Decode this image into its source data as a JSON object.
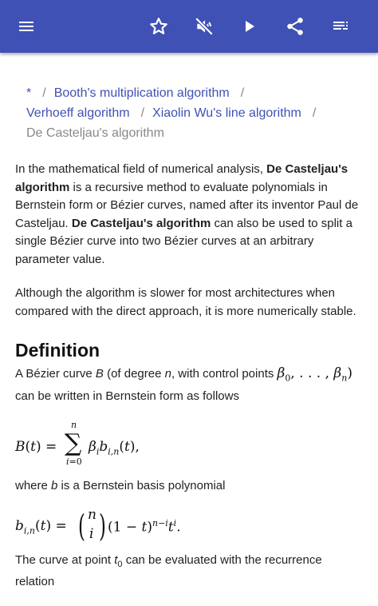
{
  "toolbar": {
    "menu_icon": "menu-icon",
    "actions": [
      "star-icon",
      "volume-off-icon",
      "play-icon",
      "share-icon",
      "playlist-icon"
    ],
    "color": "#3f51b5"
  },
  "breadcrumb": {
    "items": [
      "*",
      "Booth's multiplication algorithm",
      "Verhoeff algorithm",
      "Xiaolin Wu's line algorithm"
    ],
    "separator": "/",
    "current": "De Casteljau's algorithm"
  },
  "article": {
    "intro": {
      "t1": "In the mathematical field of numerical analysis, ",
      "b1": "De Casteljau's algorithm",
      "t2": " is a recursive method to evaluate polynomials in Bernstein form or Bézier curves, named after its inventor Paul de Casteljau. ",
      "b2": "De Casteljau's algorithm",
      "t3": " can also be used to split a single Bézier curve into two Bézier curves at an arbitrary parameter value."
    },
    "para2": "Although the algorithm is slower for most architectures when compared with the direct approach, it is more numerically stable.",
    "section_title": "Definition",
    "def": {
      "t1": "A Bézier curve ",
      "v1": "B",
      "t2": " (of degree ",
      "v2": "n",
      "t3": ", with control points ",
      "t4": " can be written in Bernstein form as follows"
    },
    "where": {
      "t1": "where ",
      "v1": "b",
      "t2": " is a Bernstein basis polynomial"
    },
    "recur": {
      "t1": "The curve at point ",
      "v1": "t",
      "sub": "0",
      "t2": " can be evaluated with the recurrence relation"
    }
  }
}
